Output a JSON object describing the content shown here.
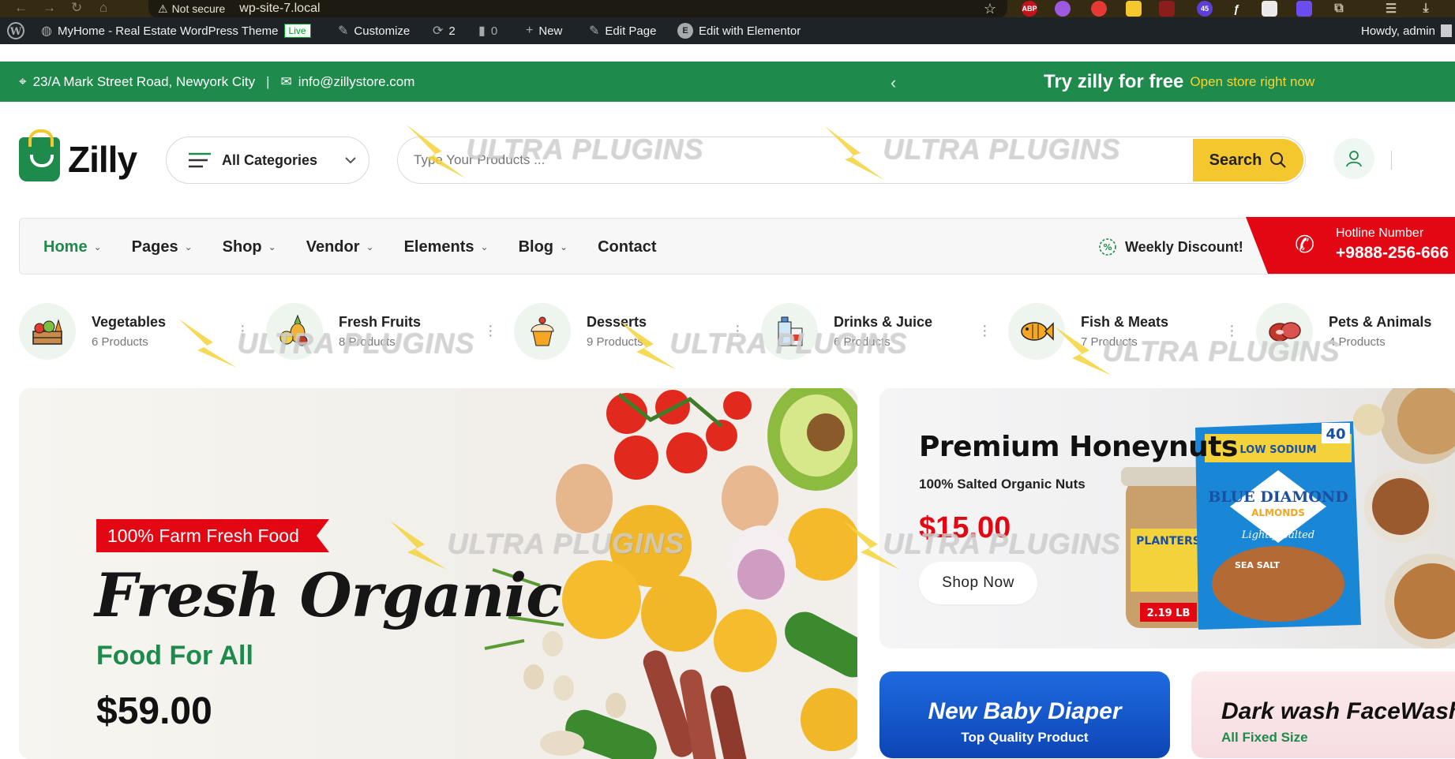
{
  "browser": {
    "security": "Not secure",
    "url": "wp-site-7.local",
    "badge_count": "45",
    "ext_abp": "ABP"
  },
  "wp_admin": {
    "site_name": "MyHome - Real Estate WordPress Theme",
    "live": "Live",
    "customize": "Customize",
    "updates": "2",
    "comments": "0",
    "new": "New",
    "edit_page": "Edit Page",
    "edit_elementor": "Edit with Elementor",
    "howdy": "Howdy, admin"
  },
  "top_strip": {
    "address": "23/A Mark Street Road, Newyork City",
    "separator": "|",
    "email": "info@zillystore.com",
    "promo_big": "Try zilly for free",
    "promo_small": "Open store right now"
  },
  "header": {
    "logo": "Zilly",
    "categories_label": "All Categories",
    "search_placeholder": "Type Your Products ...",
    "search_button": "Search"
  },
  "nav": {
    "items": [
      {
        "label": "Home",
        "dropdown": true
      },
      {
        "label": "Pages",
        "dropdown": true
      },
      {
        "label": "Shop",
        "dropdown": true
      },
      {
        "label": "Vendor",
        "dropdown": true
      },
      {
        "label": "Elements",
        "dropdown": true
      },
      {
        "label": "Blog",
        "dropdown": true
      },
      {
        "label": "Contact",
        "dropdown": false
      }
    ],
    "weekly": "Weekly Discount!",
    "hotline_label": "Hotline Number",
    "hotline_number": "+9888-256-666"
  },
  "categories": [
    {
      "name": "Vegetables",
      "count": "6 Products",
      "icon": "vegetable-crate-icon"
    },
    {
      "name": "Fresh Fruits",
      "count": "8 Products",
      "icon": "fruit-basket-icon"
    },
    {
      "name": "Desserts",
      "count": "9 Products",
      "icon": "cupcake-icon"
    },
    {
      "name": "Drinks & Juice",
      "count": "6 Products",
      "icon": "juice-bottle-icon"
    },
    {
      "name": "Fish & Meats",
      "count": "7 Products",
      "icon": "fish-icon"
    },
    {
      "name": "Pets & Animals",
      "count": "4 Products",
      "icon": "meat-icon"
    }
  ],
  "hero": {
    "tag": "100% Farm Fresh Food",
    "title": "Fresh Organic",
    "subtitle": "Food For All",
    "price": "$59.00"
  },
  "promo_nuts": {
    "title": "Premium Honeynuts",
    "subtitle": "100% Salted Organic Nuts",
    "price": "$15.00",
    "button": "Shop Now",
    "pack_brand": "BLUE DIAMOND",
    "pack_sub": "ALMONDS",
    "pack_flavor": "Lightly Salted",
    "pack_top": "LOW SODIUM",
    "pack_size": "40",
    "jar_brand": "PLANTERS",
    "jar_weight": "2.19 LB",
    "pack_seasalt": "SEA SALT"
  },
  "promo_baby": {
    "title": "New Baby Diaper",
    "subtitle": "Top Quality Product"
  },
  "promo_face": {
    "title": "Dark wash FaceWash",
    "subtitle": "All Fixed Size"
  },
  "watermark": "ULTRA PLUGINS",
  "colors": {
    "brand_green": "#1e8a4c",
    "accent_yellow": "#f4c72f",
    "hotline_red": "#e30613",
    "promo_blue": "#1e6be0"
  }
}
